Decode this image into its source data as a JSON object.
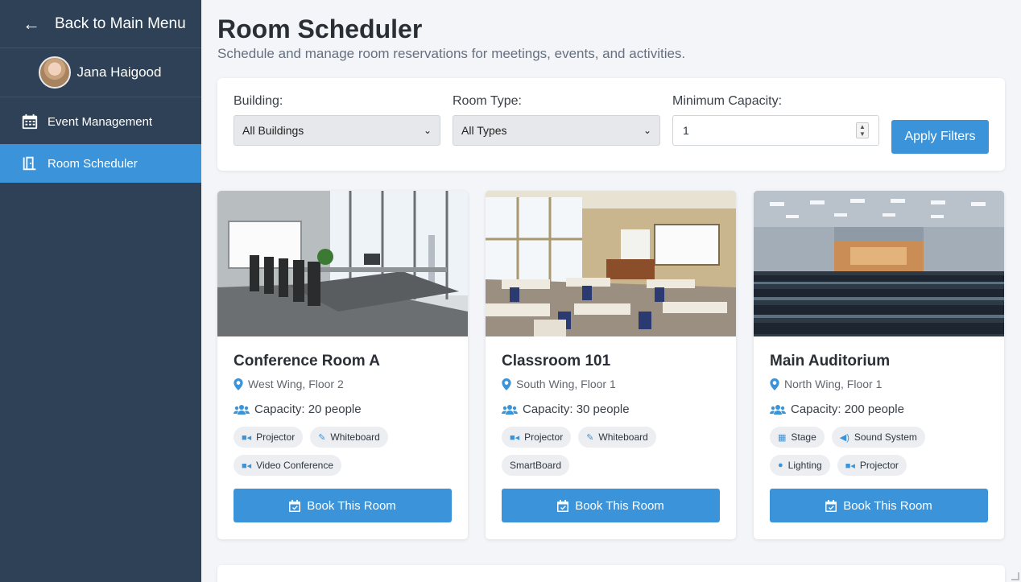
{
  "sidebar": {
    "back_label": "Back to Main Menu",
    "back_arrow": "←",
    "user_name": "Jana Haigood",
    "items": [
      {
        "label": "Event Management",
        "icon": "calendar-icon"
      },
      {
        "label": "Room Scheduler",
        "icon": "door-icon",
        "active": true
      }
    ]
  },
  "header": {
    "title": "Room Scheduler",
    "subtitle": "Schedule and manage room reservations for meetings, events, and activities."
  },
  "filters": {
    "building_label": "Building:",
    "building_value": "All Buildings",
    "room_type_label": "Room Type:",
    "room_type_value": "All Types",
    "capacity_label": "Minimum Capacity:",
    "capacity_value": "1",
    "apply_label": "Apply Filters"
  },
  "rooms": [
    {
      "name": "Conference Room A",
      "location": "West Wing, Floor 2",
      "capacity": "Capacity: 20 people",
      "amenities": [
        {
          "label": "Projector",
          "icon": "video-camera-icon"
        },
        {
          "label": "Whiteboard",
          "icon": "edit-icon"
        },
        {
          "label": "Video Conference",
          "icon": "video-camera-icon"
        }
      ],
      "book_label": "Book This Room"
    },
    {
      "name": "Classroom 101",
      "location": "South Wing, Floor 1",
      "capacity": "Capacity: 30 people",
      "amenities": [
        {
          "label": "Projector",
          "icon": "video-camera-icon"
        },
        {
          "label": "Whiteboard",
          "icon": "edit-icon"
        },
        {
          "label": "SmartBoard",
          "icon": ""
        }
      ],
      "book_label": "Book This Room"
    },
    {
      "name": "Main Auditorium",
      "location": "North Wing, Floor 1",
      "capacity": "Capacity: 200 people",
      "amenities": [
        {
          "label": "Stage",
          "icon": "building-icon"
        },
        {
          "label": "Sound System",
          "icon": "speaker-icon"
        },
        {
          "label": "Lighting",
          "icon": "lightbulb-icon"
        },
        {
          "label": "Projector",
          "icon": "video-camera-icon"
        }
      ],
      "book_label": "Book This Room"
    }
  ],
  "colors": {
    "sidebar_bg": "#2e4156",
    "accent": "#3b94d9",
    "page_bg": "#f3f5f8"
  }
}
